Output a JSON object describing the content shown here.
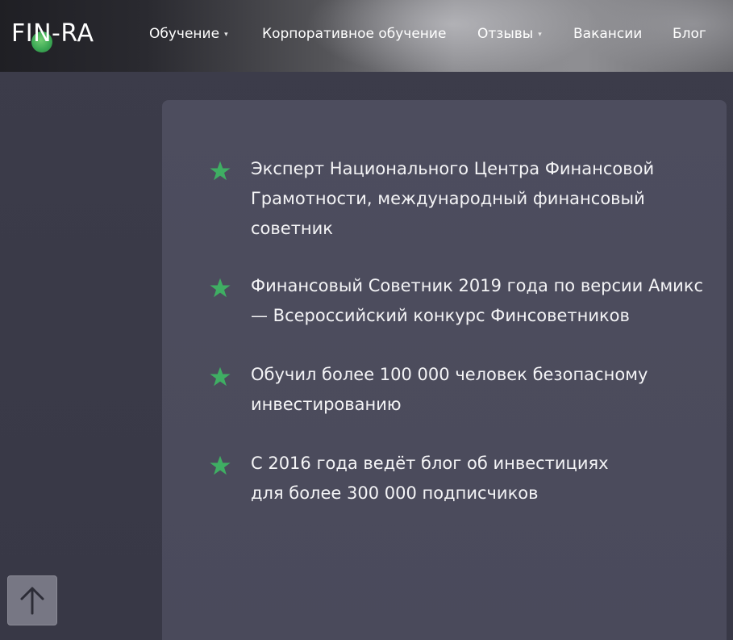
{
  "header": {
    "logo_text": "FIN-RA",
    "nav": [
      {
        "label": "Обучение",
        "has_dropdown": true
      },
      {
        "label": "Корпоративное обучение",
        "has_dropdown": false
      },
      {
        "label": "Отзывы",
        "has_dropdown": true
      },
      {
        "label": "Вакансии",
        "has_dropdown": false
      },
      {
        "label": "Блог",
        "has_dropdown": false
      }
    ],
    "dropdown_caret": "▾"
  },
  "achievements": [
    {
      "lines": [
        "Эксперт Национального Центра Финансовой",
        "Грамотности, международный финансовый",
        "советник"
      ]
    },
    {
      "lines": [
        "Финансовый Советник 2019 года по версии Амикс",
        "— Всероссийский конкурс Финсоветников"
      ]
    },
    {
      "lines": [
        "Обучил более 100 000 человек безопасному",
        "инвестированию"
      ]
    },
    {
      "lines": [
        "С 2016 года ведёт блог об инвестициях",
        "для более 300 000 подписчиков"
      ]
    }
  ],
  "icons": {
    "bullet": "star-icon",
    "scroll_top": "arrow-up-icon",
    "logo_dot": "green-circle"
  },
  "colors": {
    "accent_green": "#3fae63",
    "card_bg": "#4b4b5c",
    "page_bg": "#3a3a48"
  }
}
